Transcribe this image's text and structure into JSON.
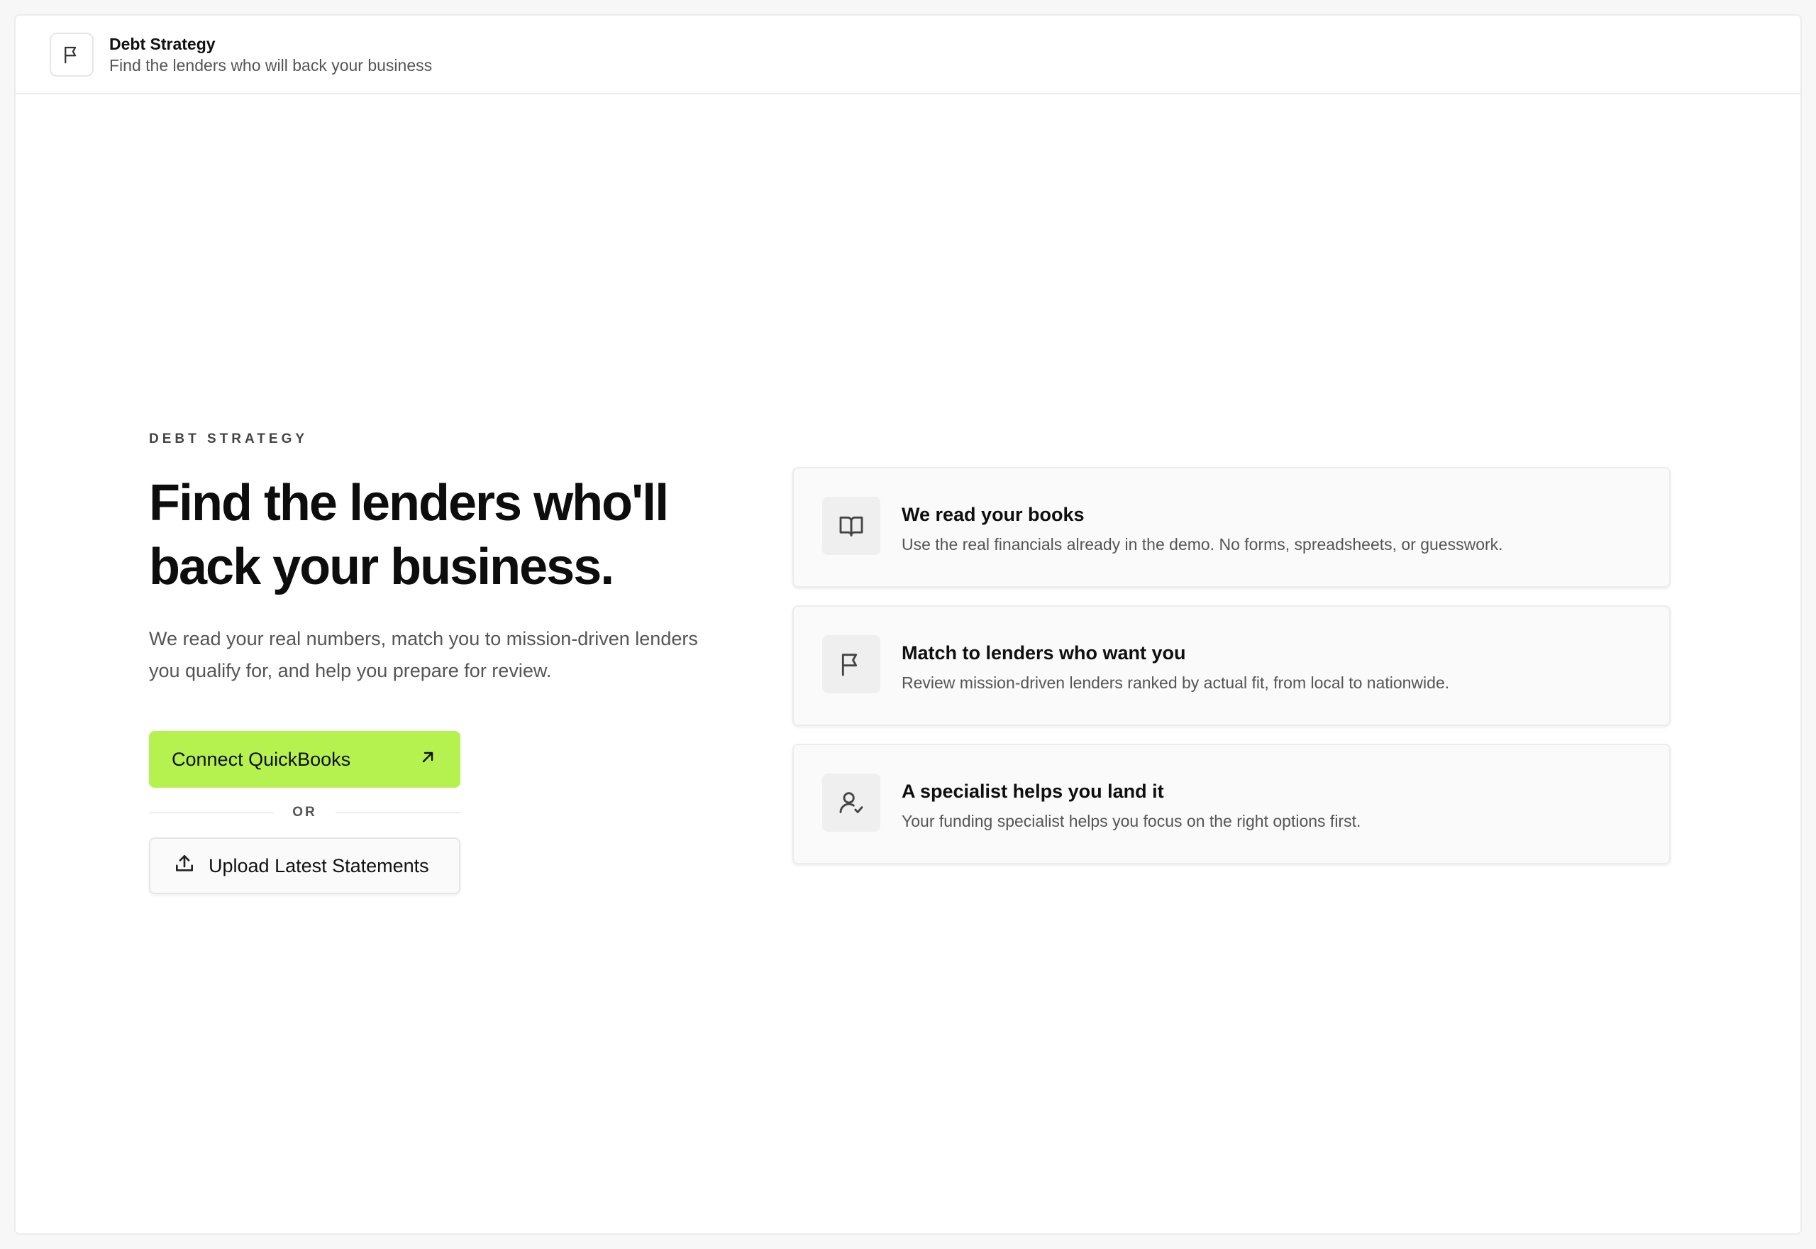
{
  "header": {
    "icon": "flag-icon",
    "title": "Debt Strategy",
    "subtitle": "Find the lenders who will back your business"
  },
  "hero": {
    "eyebrow": "DEBT STRATEGY",
    "headline": "Find the lenders who'll back your business.",
    "lead": "We read your real numbers, match you to mission-driven lenders you qualify for, and help you prepare for review."
  },
  "actions": {
    "primary_label": "Connect QuickBooks",
    "primary_icon": "arrow-up-right-icon",
    "divider_label": "OR",
    "secondary_label": "Upload Latest Statements",
    "secondary_icon": "upload-icon"
  },
  "features": [
    {
      "icon": "book-open-icon",
      "title": "We read your books",
      "description": "Use the real financials already in the demo. No forms, spreadsheets, or guesswork."
    },
    {
      "icon": "flag-icon",
      "title": "Match to lenders who want you",
      "description": "Review mission-driven lenders ranked by actual fit, from local to nationwide."
    },
    {
      "icon": "user-check-icon",
      "title": "A specialist helps you land it",
      "description": "Your funding specialist helps you focus on the right options first."
    }
  ],
  "colors": {
    "accent": "#b6f24f",
    "text": "#111111",
    "muted": "#555555",
    "card_bg": "#fafafa",
    "border": "#ececec"
  }
}
